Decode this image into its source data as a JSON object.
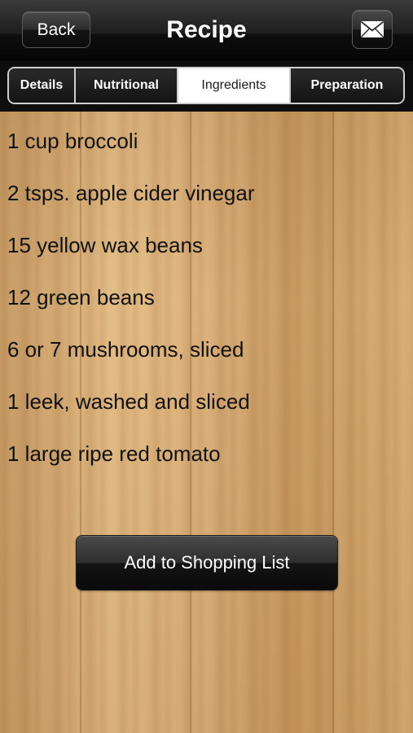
{
  "navbar": {
    "back_label": "Back",
    "title": "Recipe",
    "mail_icon": "envelope-icon"
  },
  "tabs": [
    {
      "label": "Details",
      "active": false
    },
    {
      "label": "Nutritional",
      "active": false
    },
    {
      "label": "Ingredients",
      "active": true
    },
    {
      "label": "Preparation",
      "active": false
    }
  ],
  "ingredients": [
    "1 cup broccoli",
    "2 tsps. apple cider vinegar",
    "15 yellow wax beans",
    "12 green beans",
    "6 or 7 mushrooms, sliced",
    "1 leek, washed and sliced",
    "1 large ripe red tomato"
  ],
  "actions": {
    "add_to_list_label": "Add to Shopping List"
  },
  "colors": {
    "bar_black": "#0e0e0e",
    "wood": "#d8ad75",
    "active_tab": "#ffffff"
  }
}
